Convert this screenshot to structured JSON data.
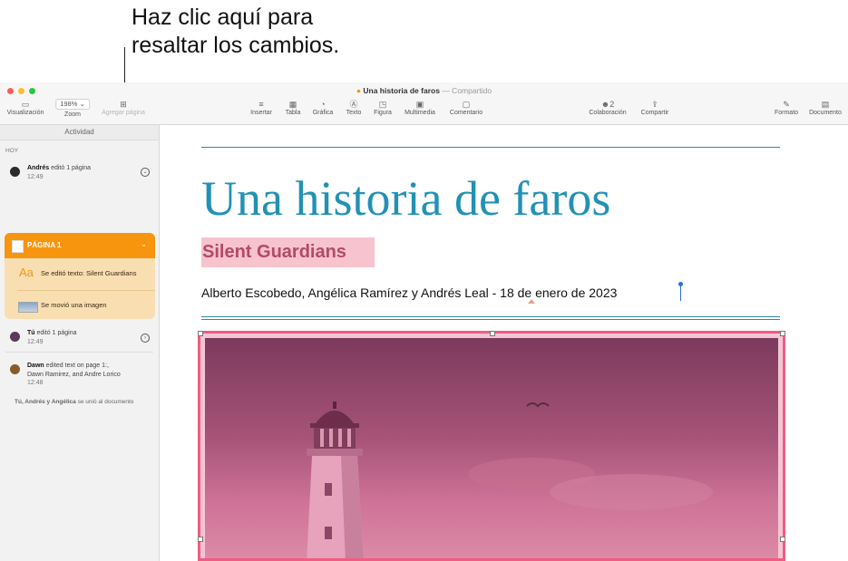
{
  "callout": {
    "line1": "Haz clic aquí para",
    "line2": "resaltar los cambios."
  },
  "window": {
    "title": "Una historia de faros",
    "title_suffix": "— Compartido",
    "traffic_lights": [
      "#fe5f57",
      "#febc2e",
      "#28c840"
    ]
  },
  "toolbar": {
    "visualizacion": "Visualización",
    "zoom_value": "198%",
    "zoom": "Zoom",
    "agregar_pagina": "Agregar página",
    "insertar": "Insertar",
    "tabla": "Tabla",
    "grafica": "Gráfica",
    "texto": "Texto",
    "figura": "Figura",
    "multimedia": "Multimedia",
    "comentario": "Comentario",
    "colaboracion": "Colaboración",
    "colaboracion_count": "2",
    "compartir": "Compartir",
    "formato": "Formato",
    "documento": "Documento"
  },
  "sidebar": {
    "header": "Actividad",
    "section": "HOY",
    "entry1": {
      "name": "Andrés",
      "action": "editó 1 página",
      "time": "12:49"
    },
    "page_card": {
      "label": "PÁGINA 1",
      "row1": "Se editó texto: Silent Guardians",
      "row1_icon": "Aa",
      "row2": "Se movió una imagen"
    },
    "entry2": {
      "name": "Tú",
      "action": "editó 1 página",
      "time": "12:49"
    },
    "entry3": {
      "name": "Dawn",
      "action": "edited text on page 1:,",
      "line2": "Dawn Ramirez, and Andre Lorico",
      "time": "12:48"
    },
    "joined": {
      "who": "Tú, Andrés y Angélica",
      "text": "se unió al documento"
    }
  },
  "document": {
    "title": "Una historia de faros",
    "subtitle": "Silent Guardians",
    "authors": "Alberto Escobedo, Angélica Ramírez y Andrés Leal - 18 de enero de 2023",
    "accent_color": "#2291b4",
    "highlight_color": "#f05c82"
  }
}
